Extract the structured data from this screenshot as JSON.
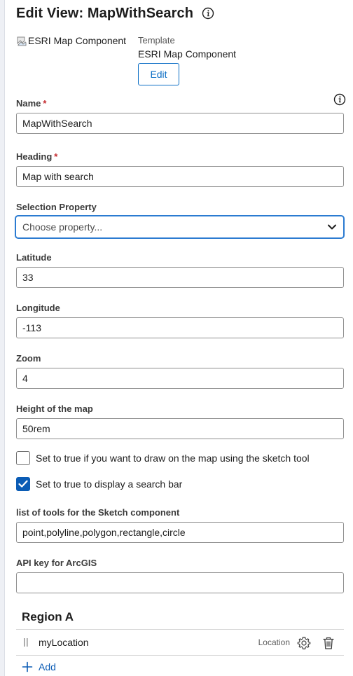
{
  "header": {
    "title": "Edit View: MapWithSearch"
  },
  "template": {
    "image_alt": "ESRI Map Component",
    "label": "Template",
    "name": "ESRI Map Component",
    "edit_label": "Edit"
  },
  "fields": {
    "name": {
      "label": "Name",
      "required_mark": "*",
      "value": "MapWithSearch"
    },
    "heading": {
      "label": "Heading",
      "required_mark": "*",
      "value": "Map with search"
    },
    "selection_property": {
      "label": "Selection Property",
      "placeholder": "Choose property..."
    },
    "latitude": {
      "label": "Latitude",
      "value": "33"
    },
    "longitude": {
      "label": "Longitude",
      "value": "-113"
    },
    "zoom": {
      "label": "Zoom",
      "value": "4"
    },
    "height": {
      "label": "Height of the map",
      "value": "50rem"
    },
    "sketch_toggle": {
      "label": "Set to true if you want to draw on the map using the sketch tool",
      "checked": false
    },
    "search_toggle": {
      "label": "Set to true to display a search bar",
      "checked": true
    },
    "sketch_tools": {
      "label": "list of tools for the Sketch component",
      "value": "point,polyline,polygon,rectangle,circle"
    },
    "api_key": {
      "label": "API key for ArcGIS",
      "value": ""
    }
  },
  "region": {
    "title": "Region A",
    "items": [
      {
        "name": "myLocation",
        "type": "Location"
      }
    ],
    "add_label": "Add"
  },
  "colors": {
    "accent": "#0b5cb5",
    "focus_border": "#2b7bd1",
    "required": "#c4292d"
  },
  "icons": [
    "info-icon",
    "broken-image-icon",
    "chevron-down-icon",
    "drag-handle-icon",
    "gear-icon",
    "trash-icon",
    "plus-icon",
    "checkmark-icon"
  ]
}
